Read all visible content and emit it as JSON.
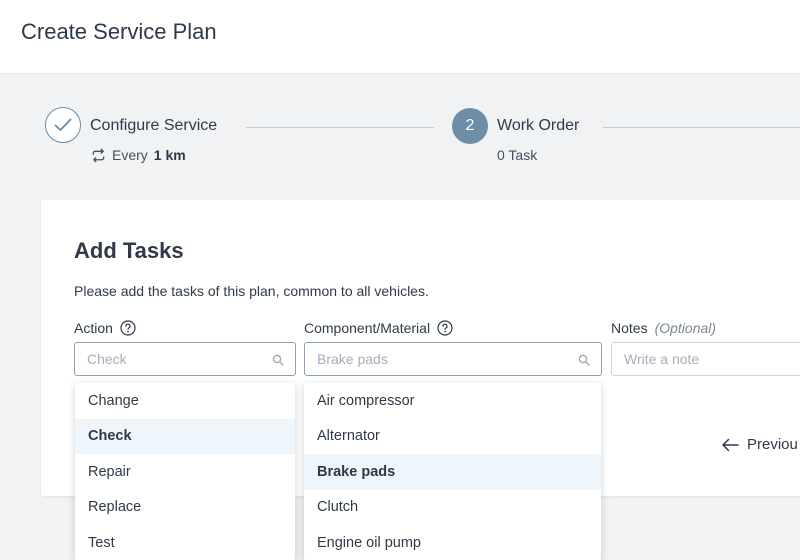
{
  "header": {
    "title": "Create Service Plan"
  },
  "stepper": {
    "steps": [
      {
        "title": "Configure Service",
        "sub_prefix": "Every",
        "sub_value": "1 km"
      },
      {
        "number": "2",
        "title": "Work Order",
        "sub": "0 Task"
      }
    ]
  },
  "card": {
    "title": "Add Tasks",
    "description": "Please add the tasks of this plan, common to all vehicles.",
    "action": {
      "label": "Action",
      "placeholder": "Check"
    },
    "component": {
      "label": "Component/Material",
      "placeholder": "Brake pads"
    },
    "notes": {
      "label": "Notes",
      "optional": "(Optional)",
      "placeholder": "Write a note"
    },
    "previous_label": "Previou"
  },
  "action_options": [
    {
      "label": "Change",
      "selected": false
    },
    {
      "label": "Check",
      "selected": true
    },
    {
      "label": "Repair",
      "selected": false
    },
    {
      "label": "Replace",
      "selected": false
    },
    {
      "label": "Test",
      "selected": false
    }
  ],
  "component_options": [
    {
      "label": "Air compressor",
      "selected": false
    },
    {
      "label": "Alternator",
      "selected": false
    },
    {
      "label": "Brake pads",
      "selected": true
    },
    {
      "label": "Clutch",
      "selected": false
    },
    {
      "label": "Engine oil pump",
      "selected": false
    }
  ],
  "colors": {
    "accent": "#6f8da7",
    "selected_bg": "#eef6fb"
  },
  "icons": [
    "check-icon",
    "repeat-icon",
    "help-icon",
    "search-icon",
    "arrow-left-icon"
  ]
}
